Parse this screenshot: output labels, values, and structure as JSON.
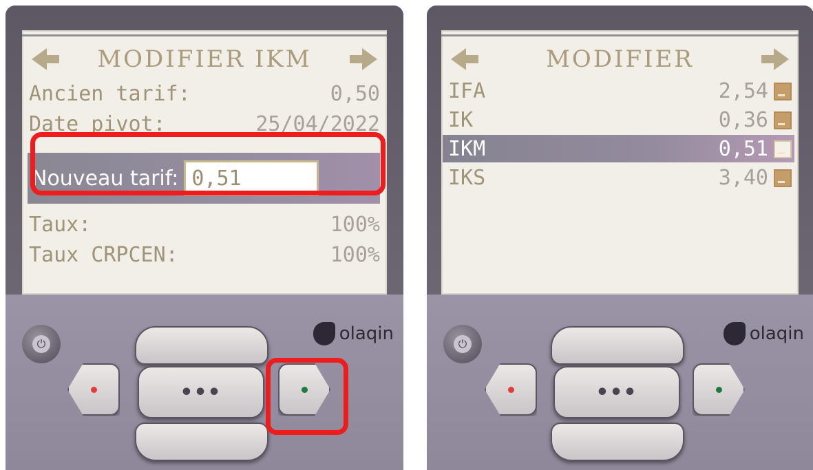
{
  "left": {
    "screen_title": "MODIFIER IKM",
    "rows": [
      {
        "label": "Ancien tarif:",
        "value": "0,50"
      },
      {
        "label": "Date pivot:",
        "value": "25/04/2022"
      }
    ],
    "edit": {
      "label": "Nouveau tarif:",
      "value": "0,51"
    },
    "rows_after": [
      {
        "label": "Taux:",
        "value": "100%"
      },
      {
        "label": "Taux CRPCEN:",
        "value": "100%"
      }
    ],
    "logo_text": "olaqin",
    "menu_button": "•••"
  },
  "right": {
    "screen_title": "MODIFIER",
    "items": [
      {
        "label": "IFA",
        "value": "2,54"
      },
      {
        "label": "IK",
        "value": "0,36"
      },
      {
        "label": "IKM",
        "value": "0,51",
        "selected": true
      },
      {
        "label": "IKS",
        "value": "3,40"
      }
    ],
    "logo_text": "olaqin",
    "menu_button": "•••"
  },
  "colors": {
    "highlight_red": "#ee1c1c",
    "screen_text": "#a09478",
    "checkbox": "#c49e6a"
  },
  "icons": [
    "arrow-left-icon",
    "arrow-right-icon",
    "power-icon",
    "olaqin-logo-icon",
    "checkbox-icon"
  ]
}
